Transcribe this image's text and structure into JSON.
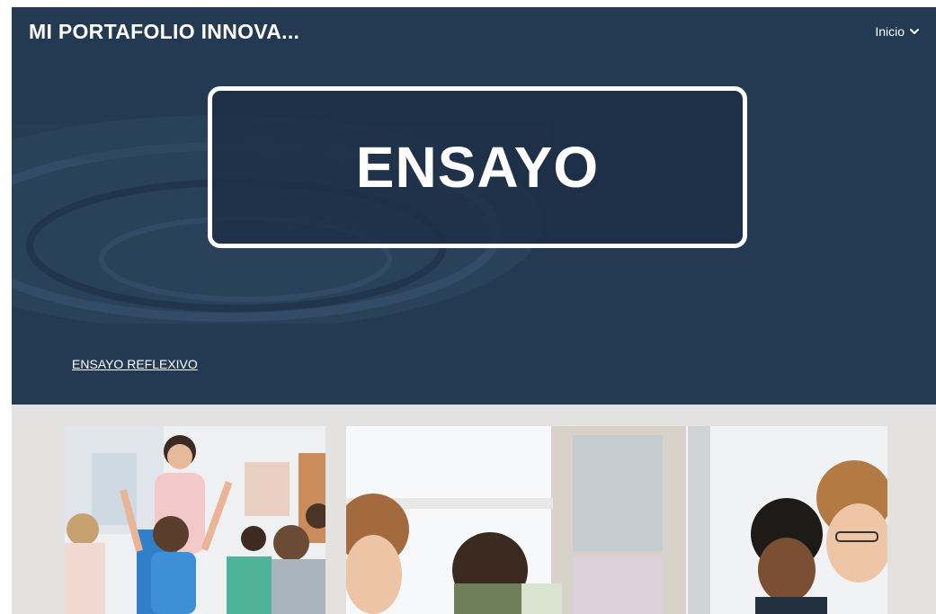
{
  "header": {
    "site_title": "MI PORTAFOLIO INNOVA...",
    "nav_label": "Inicio",
    "nav_icon": "chevron-down-icon"
  },
  "hero": {
    "title": "ENSAYO"
  },
  "links": {
    "essay_link": "ENSAYO REFLEXIVO"
  },
  "colors": {
    "header_bg": "#243a52",
    "content_bg": "#e3e2e0",
    "text": "#ffffff"
  }
}
